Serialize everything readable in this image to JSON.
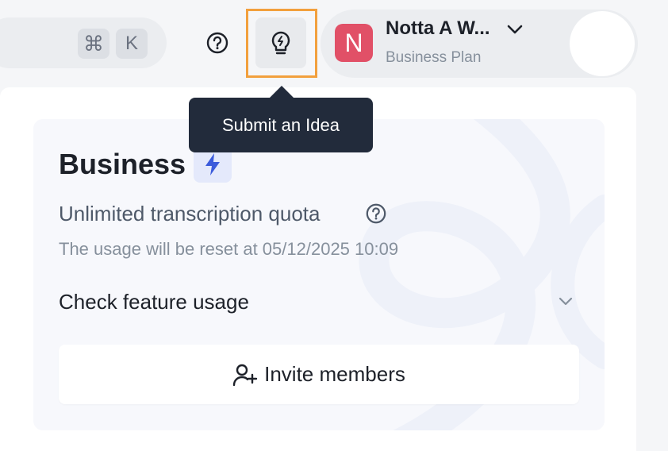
{
  "header": {
    "shortcut_keys": [
      "⌘",
      "K"
    ],
    "help_icon": "question-circle-icon",
    "idea_icon": "lightbulb-icon",
    "tooltip": "Submit an Idea",
    "account": {
      "initial": "N",
      "name": "Notta A W...",
      "plan": "Business Plan",
      "avatar_color": "#e15067"
    }
  },
  "plan_card": {
    "title": "Business",
    "badge_icon": "lightning-bolt-icon",
    "quota": "Unlimited transcription quota",
    "reset_notice": "The usage will be reset at 05/12/2025 10:09",
    "feature_usage_label": "Check feature usage",
    "invite_button_label": "Invite members"
  },
  "colors": {
    "highlight": "#f2a03d",
    "accent_blue": "#3b5bdb",
    "tooltip_bg": "#222b3b"
  }
}
